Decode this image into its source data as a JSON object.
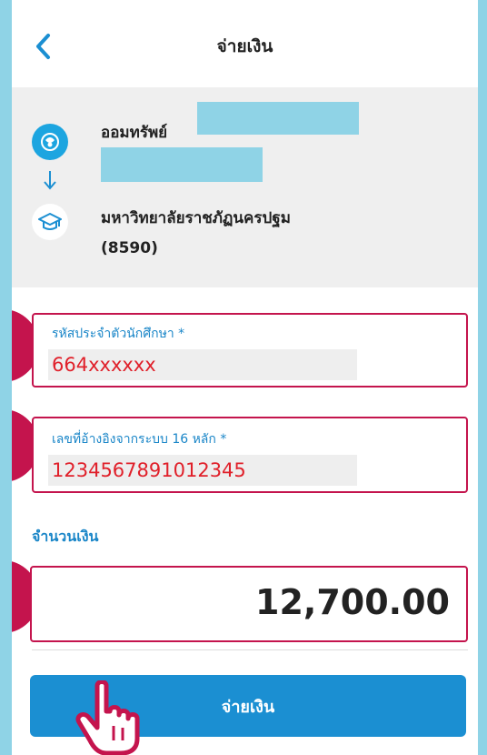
{
  "header": {
    "title": "จ่ายเงิน"
  },
  "from_account": {
    "label": "ออมทรัพย์"
  },
  "to_account": {
    "name": "มหาวิทยาลัยราชภัฏนครปฐม",
    "code": "(8590)"
  },
  "fields": [
    {
      "label": "รหัสประจำตัวนักศึกษา *",
      "value": "664xxxxxx"
    },
    {
      "label": "เลขที่อ้างอิงจากระบบ 16 หลัก *",
      "value": "1234567891012345"
    }
  ],
  "amount": {
    "label": "จำนวนเงิน",
    "value": "12,700.00"
  },
  "pay_button": {
    "label": "จ่ายเงิน"
  },
  "icons": [
    "back-icon",
    "bank-logo-icon",
    "arrow-down-icon",
    "graduation-cap-icon",
    "hand-pointer-icon"
  ],
  "colors": {
    "accent": "#1b8fd2",
    "highlight": "#c4144d",
    "value_red": "#e0202a",
    "background": "#8fd3e6"
  }
}
